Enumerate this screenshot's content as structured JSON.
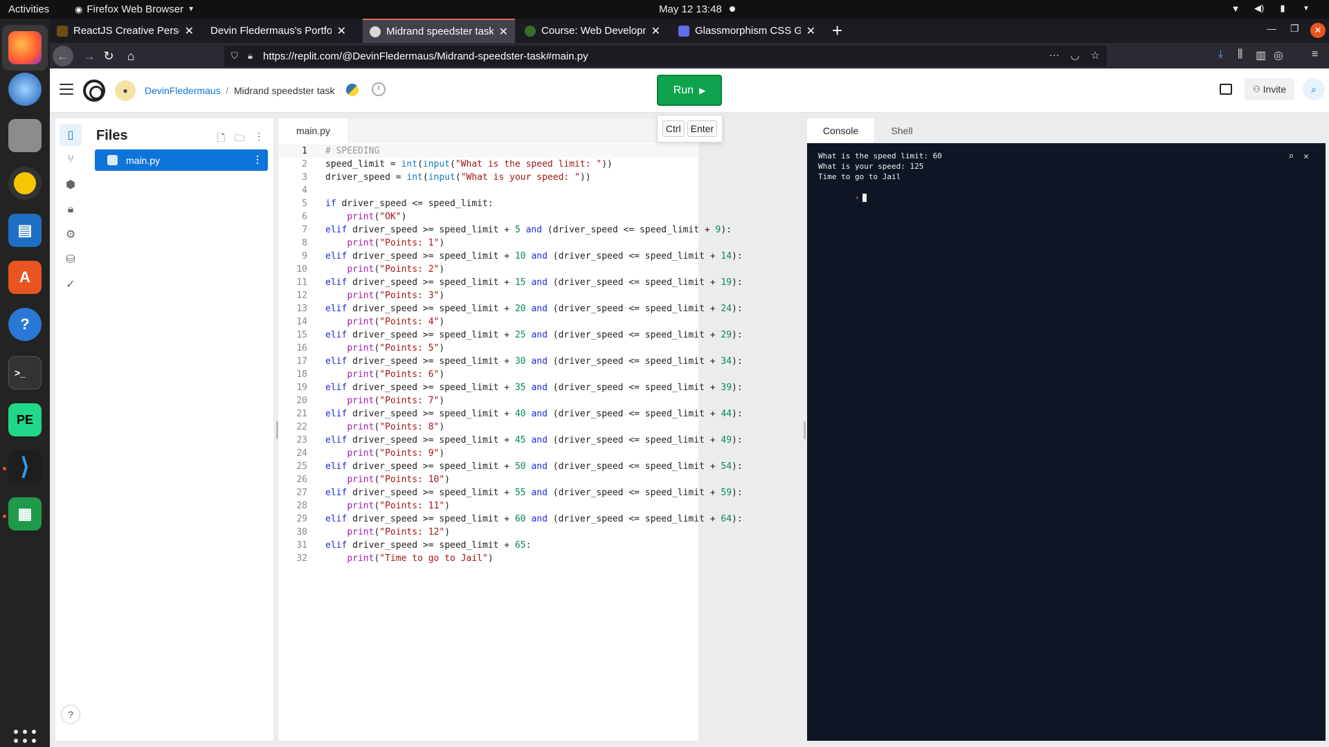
{
  "system": {
    "activities": "Activities",
    "app_name": "Firefox Web Browser",
    "clock": "May 12  13:48"
  },
  "browser": {
    "tabs": [
      {
        "title": "ReactJS Creative Person",
        "icon_color": "#6b4e16"
      },
      {
        "title": "Devin Fledermaus's Portfoli",
        "icon_color": "#2b2a33"
      },
      {
        "title": "Midrand speedster task",
        "icon_color": "#d8d8d8"
      },
      {
        "title": "Course: Web Developme",
        "icon_color": "#3a6d2a"
      },
      {
        "title": "Glassmorphism CSS Gen",
        "icon_color": "#5f6ee8"
      }
    ],
    "url": "https://replit.com/@DevinFledermaus/Midrand-speedster-task#main.py"
  },
  "replit": {
    "user": "DevinFledermaus",
    "separator": "/",
    "project": "Midrand speedster task",
    "run_label": "Run",
    "invite_label": "Invite",
    "shortcut_keys": [
      "Ctrl",
      "Enter"
    ],
    "files_title": "Files",
    "active_file": "main.py",
    "editor_tab": "main.py",
    "console_tab": "Console",
    "shell_tab": "Shell",
    "help": "?"
  },
  "code": [
    [
      [
        "cm",
        "# SPEEDING"
      ]
    ],
    [
      [
        "",
        "speed_limit = "
      ],
      [
        "bi",
        "int"
      ],
      [
        "",
        "("
      ],
      [
        "bi",
        "input"
      ],
      [
        "",
        "("
      ],
      [
        "st",
        "\"What is the speed limit: \""
      ],
      [
        "",
        "))"
      ]
    ],
    [
      [
        "",
        "driver_speed = "
      ],
      [
        "bi",
        "int"
      ],
      [
        "",
        "("
      ],
      [
        "bi",
        "input"
      ],
      [
        "",
        "("
      ],
      [
        "st",
        "\"What is your speed: \""
      ],
      [
        "",
        "))"
      ]
    ],
    [],
    [
      [
        "kw",
        "if"
      ],
      [
        "",
        " driver_speed <= speed_limit:"
      ]
    ],
    [
      [
        "",
        "    "
      ],
      [
        "fn",
        "print"
      ],
      [
        "",
        "("
      ],
      [
        "st",
        "\"OK\""
      ],
      [
        "",
        ")"
      ]
    ],
    [
      [
        "kw",
        "elif"
      ],
      [
        "",
        " driver_speed >= speed_limit + "
      ],
      [
        "nu",
        "5"
      ],
      [
        "",
        " "
      ],
      [
        "kw",
        "and"
      ],
      [
        "",
        " (driver_speed <= speed_limit + "
      ],
      [
        "nu",
        "9"
      ],
      [
        "",
        "):"
      ]
    ],
    [
      [
        "",
        "    "
      ],
      [
        "fn",
        "print"
      ],
      [
        "",
        "("
      ],
      [
        "st",
        "\"Points: 1\""
      ],
      [
        "",
        ")"
      ]
    ],
    [
      [
        "kw",
        "elif"
      ],
      [
        "",
        " driver_speed >= speed_limit + "
      ],
      [
        "nu",
        "10"
      ],
      [
        "",
        " "
      ],
      [
        "kw",
        "and"
      ],
      [
        "",
        " (driver_speed <= speed_limit + "
      ],
      [
        "nu",
        "14"
      ],
      [
        "",
        "):"
      ]
    ],
    [
      [
        "",
        "    "
      ],
      [
        "fn",
        "print"
      ],
      [
        "",
        "("
      ],
      [
        "st",
        "\"Points: 2\""
      ],
      [
        "",
        ")"
      ]
    ],
    [
      [
        "kw",
        "elif"
      ],
      [
        "",
        " driver_speed >= speed_limit + "
      ],
      [
        "nu",
        "15"
      ],
      [
        "",
        " "
      ],
      [
        "kw",
        "and"
      ],
      [
        "",
        " (driver_speed <= speed_limit + "
      ],
      [
        "nu",
        "19"
      ],
      [
        "",
        "):"
      ]
    ],
    [
      [
        "",
        "    "
      ],
      [
        "fn",
        "print"
      ],
      [
        "",
        "("
      ],
      [
        "st",
        "\"Points: 3\""
      ],
      [
        "",
        ")"
      ]
    ],
    [
      [
        "kw",
        "elif"
      ],
      [
        "",
        " driver_speed >= speed_limit + "
      ],
      [
        "nu",
        "20"
      ],
      [
        "",
        " "
      ],
      [
        "kw",
        "and"
      ],
      [
        "",
        " (driver_speed <= speed_limit + "
      ],
      [
        "nu",
        "24"
      ],
      [
        "",
        "):"
      ]
    ],
    [
      [
        "",
        "    "
      ],
      [
        "fn",
        "print"
      ],
      [
        "",
        "("
      ],
      [
        "st",
        "\"Points: 4\""
      ],
      [
        "",
        ")"
      ]
    ],
    [
      [
        "kw",
        "elif"
      ],
      [
        "",
        " driver_speed >= speed_limit + "
      ],
      [
        "nu",
        "25"
      ],
      [
        "",
        " "
      ],
      [
        "kw",
        "and"
      ],
      [
        "",
        " (driver_speed <= speed_limit + "
      ],
      [
        "nu",
        "29"
      ],
      [
        "",
        "):"
      ]
    ],
    [
      [
        "",
        "    "
      ],
      [
        "fn",
        "print"
      ],
      [
        "",
        "("
      ],
      [
        "st",
        "\"Points: 5\""
      ],
      [
        "",
        ")"
      ]
    ],
    [
      [
        "kw",
        "elif"
      ],
      [
        "",
        " driver_speed >= speed_limit + "
      ],
      [
        "nu",
        "30"
      ],
      [
        "",
        " "
      ],
      [
        "kw",
        "and"
      ],
      [
        "",
        " (driver_speed <= speed_limit + "
      ],
      [
        "nu",
        "34"
      ],
      [
        "",
        "):"
      ]
    ],
    [
      [
        "",
        "    "
      ],
      [
        "fn",
        "print"
      ],
      [
        "",
        "("
      ],
      [
        "st",
        "\"Points: 6\""
      ],
      [
        "",
        ")"
      ]
    ],
    [
      [
        "kw",
        "elif"
      ],
      [
        "",
        " driver_speed >= speed_limit + "
      ],
      [
        "nu",
        "35"
      ],
      [
        "",
        " "
      ],
      [
        "kw",
        "and"
      ],
      [
        "",
        " (driver_speed <= speed_limit + "
      ],
      [
        "nu",
        "39"
      ],
      [
        "",
        "):"
      ]
    ],
    [
      [
        "",
        "    "
      ],
      [
        "fn",
        "print"
      ],
      [
        "",
        "("
      ],
      [
        "st",
        "\"Points: 7\""
      ],
      [
        "",
        ")"
      ]
    ],
    [
      [
        "kw",
        "elif"
      ],
      [
        "",
        " driver_speed >= speed_limit + "
      ],
      [
        "nu",
        "40"
      ],
      [
        "",
        " "
      ],
      [
        "kw",
        "and"
      ],
      [
        "",
        " (driver_speed <= speed_limit + "
      ],
      [
        "nu",
        "44"
      ],
      [
        "",
        "):"
      ]
    ],
    [
      [
        "",
        "    "
      ],
      [
        "fn",
        "print"
      ],
      [
        "",
        "("
      ],
      [
        "st",
        "\"Points: 8\""
      ],
      [
        "",
        ")"
      ]
    ],
    [
      [
        "kw",
        "elif"
      ],
      [
        "",
        " driver_speed >= speed_limit + "
      ],
      [
        "nu",
        "45"
      ],
      [
        "",
        " "
      ],
      [
        "kw",
        "and"
      ],
      [
        "",
        " (driver_speed <= speed_limit + "
      ],
      [
        "nu",
        "49"
      ],
      [
        "",
        "):"
      ]
    ],
    [
      [
        "",
        "    "
      ],
      [
        "fn",
        "print"
      ],
      [
        "",
        "("
      ],
      [
        "st",
        "\"Points: 9\""
      ],
      [
        "",
        ")"
      ]
    ],
    [
      [
        "kw",
        "elif"
      ],
      [
        "",
        " driver_speed >= speed_limit + "
      ],
      [
        "nu",
        "50"
      ],
      [
        "",
        " "
      ],
      [
        "kw",
        "and"
      ],
      [
        "",
        " (driver_speed <= speed_limit + "
      ],
      [
        "nu",
        "54"
      ],
      [
        "",
        "):"
      ]
    ],
    [
      [
        "",
        "    "
      ],
      [
        "fn",
        "print"
      ],
      [
        "",
        "("
      ],
      [
        "st",
        "\"Points: 10\""
      ],
      [
        "",
        ")"
      ]
    ],
    [
      [
        "kw",
        "elif"
      ],
      [
        "",
        " driver_speed >= speed_limit + "
      ],
      [
        "nu",
        "55"
      ],
      [
        "",
        " "
      ],
      [
        "kw",
        "and"
      ],
      [
        "",
        " (driver_speed <= speed_limit + "
      ],
      [
        "nu",
        "59"
      ],
      [
        "",
        "):"
      ]
    ],
    [
      [
        "",
        "    "
      ],
      [
        "fn",
        "print"
      ],
      [
        "",
        "("
      ],
      [
        "st",
        "\"Points: 11\""
      ],
      [
        "",
        ")"
      ]
    ],
    [
      [
        "kw",
        "elif"
      ],
      [
        "",
        " driver_speed >= speed_limit + "
      ],
      [
        "nu",
        "60"
      ],
      [
        "",
        " "
      ],
      [
        "kw",
        "and"
      ],
      [
        "",
        " (driver_speed <= speed_limit + "
      ],
      [
        "nu",
        "64"
      ],
      [
        "",
        "):"
      ]
    ],
    [
      [
        "",
        "    "
      ],
      [
        "fn",
        "print"
      ],
      [
        "",
        "("
      ],
      [
        "st",
        "\"Points: 12\""
      ],
      [
        "",
        ")"
      ]
    ],
    [
      [
        "kw",
        "elif"
      ],
      [
        "",
        " driver_speed >= speed_limit + "
      ],
      [
        "nu",
        "65"
      ],
      [
        "",
        ":"
      ]
    ],
    [
      [
        "",
        "    "
      ],
      [
        "fn",
        "print"
      ],
      [
        "",
        "("
      ],
      [
        "st",
        "\"Time to go to Jail\""
      ],
      [
        "",
        ")"
      ]
    ]
  ],
  "console": {
    "lines": [
      "What is the speed limit: 60",
      "What is your speed: 125",
      "Time to go to Jail"
    ],
    "prompt": "›"
  },
  "colors": {
    "run_green": "#0fa34d",
    "replit_blue": "#0f74d9",
    "console_bg": "#0e1525",
    "tab_accent": "#e66b4a"
  }
}
